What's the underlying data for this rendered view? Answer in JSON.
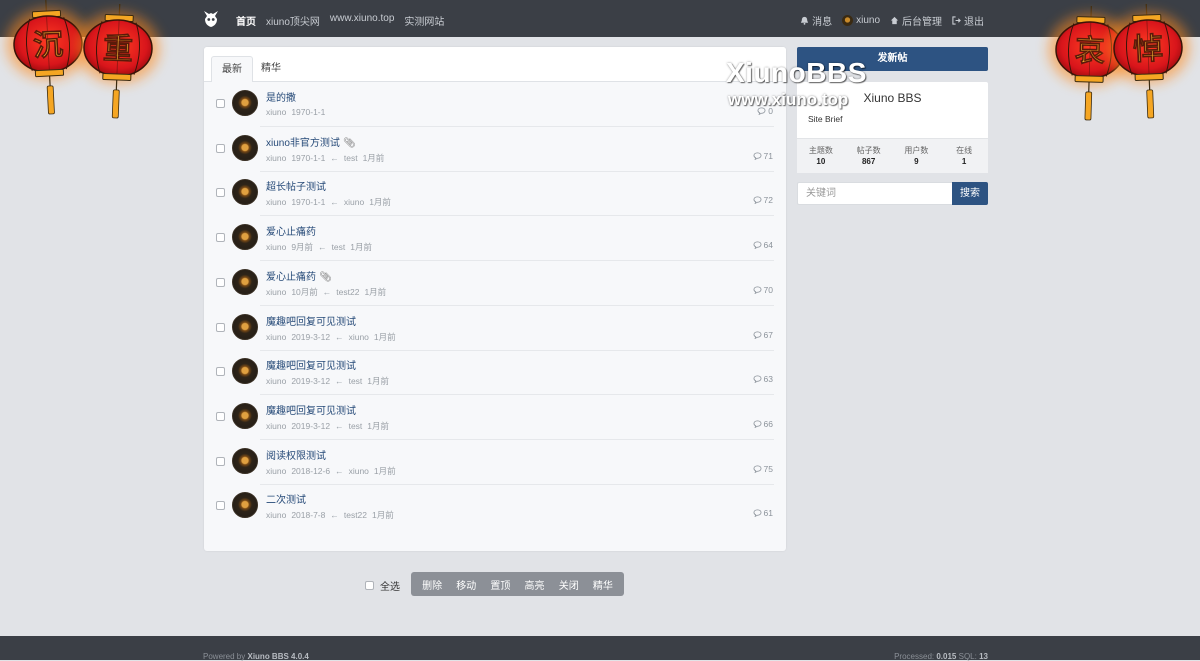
{
  "nav": {
    "left": [
      "首页",
      "xiuno顶尖网",
      "www.xiuno.top",
      "实测网站"
    ],
    "right": {
      "messages": "消息",
      "user": "xiuno",
      "admin": "后台管理",
      "logout": "退出"
    }
  },
  "tabs": [
    "最新",
    "精华"
  ],
  "threads": [
    {
      "title": "是的撒",
      "author": "xiuno",
      "date": "1970-1-1",
      "last_user": "",
      "last_time": "",
      "replies": "0",
      "attach": false
    },
    {
      "title": "xiuno非官方测试",
      "author": "xiuno",
      "date": "1970-1-1",
      "last_user": "test",
      "last_time": "1月前",
      "replies": "71",
      "attach": true
    },
    {
      "title": "超长帖子测试",
      "author": "xiuno",
      "date": "1970-1-1",
      "last_user": "xiuno",
      "last_time": "1月前",
      "replies": "72",
      "attach": false
    },
    {
      "title": "爱心止痛药",
      "author": "xiuno",
      "date": "9月前",
      "last_user": "test",
      "last_time": "1月前",
      "replies": "64",
      "attach": false
    },
    {
      "title": "爱心止痛药",
      "author": "xiuno",
      "date": "10月前",
      "last_user": "test22",
      "last_time": "1月前",
      "replies": "70",
      "attach": true
    },
    {
      "title": "魔趣吧回复可见测试",
      "author": "xiuno",
      "date": "2019-3-12",
      "last_user": "xiuno",
      "last_time": "1月前",
      "replies": "67",
      "attach": false
    },
    {
      "title": "魔趣吧回复可见测试",
      "author": "xiuno",
      "date": "2019-3-12",
      "last_user": "test",
      "last_time": "1月前",
      "replies": "63",
      "attach": false
    },
    {
      "title": "魔趣吧回复可见测试",
      "author": "xiuno",
      "date": "2019-3-12",
      "last_user": "test",
      "last_time": "1月前",
      "replies": "66",
      "attach": false
    },
    {
      "title": "阅读权限测试",
      "author": "xiuno",
      "date": "2018-12-6",
      "last_user": "xiuno",
      "last_time": "1月前",
      "replies": "75",
      "attach": false
    },
    {
      "title": "二次测试",
      "author": "xiuno",
      "date": "2018-7-8",
      "last_user": "test22",
      "last_time": "1月前",
      "replies": "61",
      "attach": false
    }
  ],
  "bulk": {
    "select_all": "全选",
    "actions": [
      "删除",
      "移动",
      "置顶",
      "高亮",
      "关闭",
      "精华"
    ]
  },
  "sidebar": {
    "new_post": "发新帖",
    "site_name": "Xiuno BBS",
    "site_brief": "Site Brief",
    "stats": [
      {
        "label": "主题数",
        "value": "10"
      },
      {
        "label": "帖子数",
        "value": "867"
      },
      {
        "label": "用户数",
        "value": "9"
      },
      {
        "label": "在线",
        "value": "1"
      }
    ],
    "search_placeholder": "关键词",
    "search_button": "搜索"
  },
  "watermark": {
    "line1": "XiunoBBS",
    "line2": "www.xiuno.top"
  },
  "lanterns": [
    "沉",
    "重",
    "哀",
    "悼"
  ],
  "footer": {
    "powered_prefix": "Powered by",
    "powered_name": "Xiuno BBS 4.0.4",
    "processed_prefix": "Processed:",
    "processed_value": "0.015",
    "sql_prefix": "SQL:",
    "sql_value": "13"
  },
  "colors": {
    "nav_bg": "#3b3f46",
    "accent": "#2d5382",
    "page_bg": "#e1e3e7",
    "lantern_red": "#d8151b",
    "lantern_gold": "#f5a623"
  }
}
